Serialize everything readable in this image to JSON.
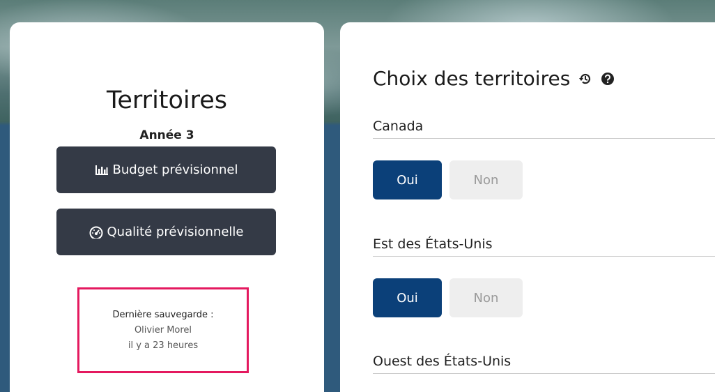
{
  "left_panel": {
    "title": "Territoires",
    "year": "Année 3",
    "budget_button": {
      "label": "Budget prévisionnel",
      "icon": "bar-chart-icon"
    },
    "quality_button": {
      "label": "Qualité prévisionnelle",
      "icon": "gauge-icon"
    },
    "last_save": {
      "label": "Dernière sauvegarde :",
      "user": "Olivier Morel",
      "time": "il y a 23 heures",
      "highlight_color": "#e4195f"
    }
  },
  "main_panel": {
    "title": "Choix des territoires",
    "icons": [
      "history-icon",
      "help-icon"
    ],
    "territories": [
      {
        "name": "Canada",
        "yes_label": "Oui",
        "no_label": "Non",
        "selected": "Oui"
      },
      {
        "name": "Est des États-Unis",
        "yes_label": "Oui",
        "no_label": "Non",
        "selected": "Oui"
      },
      {
        "name": "Ouest des États-Unis"
      }
    ]
  },
  "colors": {
    "dark_button": "#343a46",
    "primary": "#0b4079",
    "inactive": "#eeeeee"
  }
}
